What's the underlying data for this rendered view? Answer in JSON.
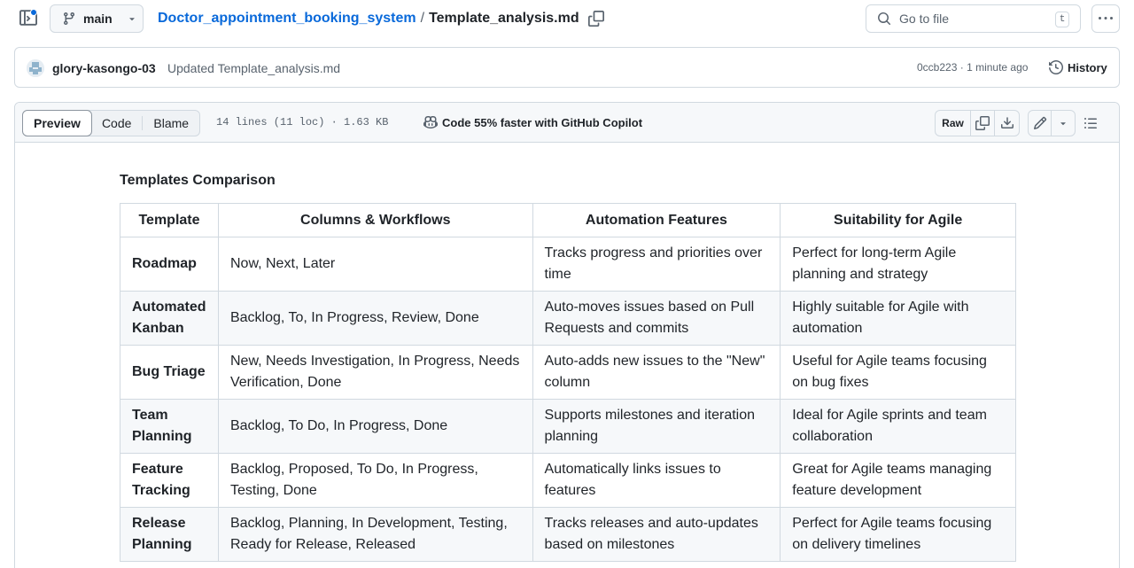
{
  "header": {
    "branch": "main",
    "repo_name": "Doctor_appointment_booking_system",
    "path_separator": "/",
    "file_name": "Template_analysis.md",
    "search_placeholder": "Go to file",
    "search_shortcut": "t"
  },
  "commit": {
    "author": "glory-kasongo-03",
    "message": "Updated Template_analysis.md",
    "sha": "0ccb223",
    "meta_separator": "·",
    "time": "1 minute ago",
    "history_label": "History"
  },
  "file_toolbar": {
    "tabs": [
      {
        "label": "Preview",
        "active": true
      },
      {
        "label": "Code",
        "active": false
      },
      {
        "label": "Blame",
        "active": false
      }
    ],
    "lines_info": "14 lines (11 loc) · 1.63 KB",
    "copilot_text": "Code 55% faster with GitHub Copilot",
    "raw_label": "Raw"
  },
  "document": {
    "title": "Templates Comparison",
    "table": {
      "headers": [
        "Template",
        "Columns & Workflows",
        "Automation Features",
        "Suitability for Agile"
      ],
      "rows": [
        [
          "Roadmap",
          "Now, Next, Later",
          "Tracks progress and priorities over time",
          "Perfect for long-term Agile planning and strategy"
        ],
        [
          "Automated Kanban",
          "Backlog, To, In Progress, Review, Done",
          "Auto-moves issues based on Pull Requests and commits",
          "Highly suitable for Agile with automation"
        ],
        [
          "Bug Triage",
          "New, Needs Investigation, In Progress, Needs Verification, Done",
          "Auto-adds new issues to the \"New\" column",
          "Useful for Agile teams focusing on bug fixes"
        ],
        [
          "Team Planning",
          "Backlog, To Do, In Progress, Done",
          "Supports milestones and iteration planning",
          "Ideal for Agile sprints and team collaboration"
        ],
        [
          "Feature Tracking",
          "Backlog, Proposed, To Do, In Progress, Testing, Done",
          "Automatically links issues to features",
          "Great for Agile teams managing feature development"
        ],
        [
          "Release Planning",
          "Backlog, Planning, In Development, Testing, Ready for Release, Released",
          "Tracks releases and auto-updates based on milestones",
          "Perfect for Agile teams focusing on delivery timelines"
        ]
      ]
    }
  },
  "colors": {
    "link": "#0969da",
    "text": "#1f2328",
    "muted": "#59636e",
    "border": "#d1d9e0",
    "subtle_bg": "#f6f8fa"
  },
  "icons": [
    "sidebar-toggle-icon",
    "git-branch-icon",
    "chevron-down-icon",
    "copy-icon",
    "search-icon",
    "kebab-horizontal-icon",
    "history-icon",
    "copilot-icon",
    "download-icon",
    "pencil-icon",
    "list-unordered-icon"
  ]
}
